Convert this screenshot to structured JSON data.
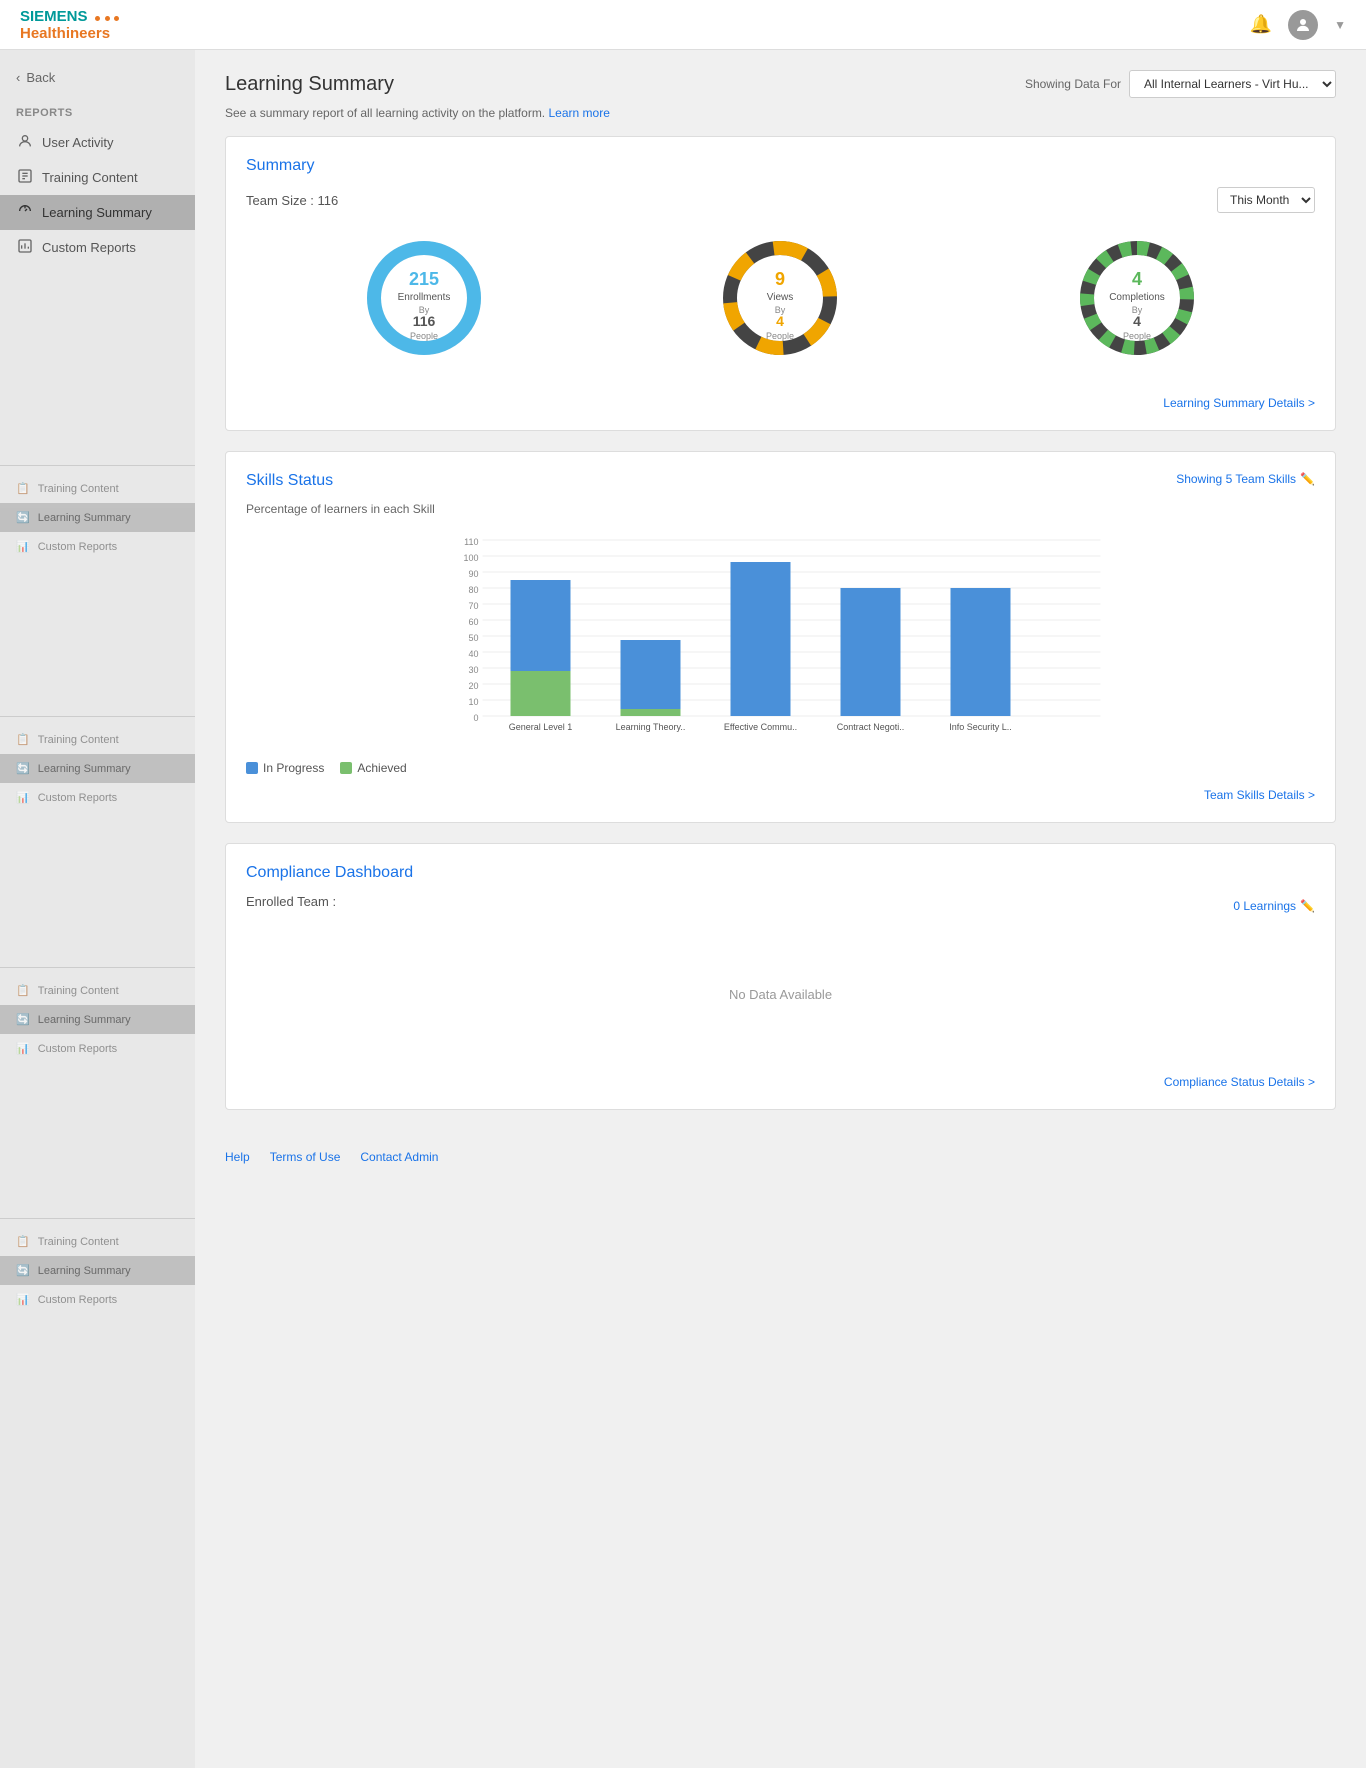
{
  "header": {
    "logo_siemens": "SIEMENS",
    "logo_healthineers": "Healthineers",
    "bell_icon": "🔔",
    "avatar_icon": "👤"
  },
  "sidebar": {
    "back_label": "Back",
    "reports_label": "REPORTS",
    "items": [
      {
        "id": "user-activity",
        "label": "User Activity",
        "icon": "👤",
        "active": false
      },
      {
        "id": "training-content",
        "label": "Training Content",
        "icon": "📋",
        "active": false
      },
      {
        "id": "learning-summary",
        "label": "Learning Summary",
        "icon": "🔄",
        "active": true
      },
      {
        "id": "custom-reports",
        "label": "Custom Reports",
        "icon": "📊",
        "active": false
      }
    ],
    "repeated_groups": [
      {
        "items": [
          {
            "label": "Training Content",
            "icon": "📋"
          },
          {
            "label": "Learning Summary",
            "icon": "🔄",
            "active": true
          },
          {
            "label": "Custom Reports",
            "icon": "📊"
          }
        ]
      },
      {
        "items": [
          {
            "label": "Training Content",
            "icon": "📋"
          },
          {
            "label": "Learning Summary",
            "icon": "🔄",
            "active": true
          },
          {
            "label": "Custom Reports",
            "icon": "📊"
          }
        ]
      },
      {
        "items": [
          {
            "label": "Training Content",
            "icon": "📋"
          },
          {
            "label": "Learning Summary",
            "icon": "🔄",
            "active": true
          },
          {
            "label": "Custom Reports",
            "icon": "📊"
          }
        ]
      },
      {
        "items": [
          {
            "label": "Training Content",
            "icon": "📋"
          },
          {
            "label": "Learning Summary",
            "icon": "🔄",
            "active": true
          },
          {
            "label": "Custom Reports",
            "icon": "📊"
          }
        ]
      }
    ]
  },
  "page": {
    "title": "Learning Summary",
    "showing_data_for_label": "Showing Data For",
    "data_selector": "All Internal Learners - Virt Hu...",
    "subtitle": "See a summary report of all learning activity on the platform.",
    "learn_more": "Learn more"
  },
  "summary_card": {
    "title": "Summary",
    "team_size_label": "Team Size : 116",
    "month_selector": "This Month",
    "enrollments": {
      "number": "215",
      "label": "Enrollments",
      "by_label": "By",
      "people_number": "116",
      "people_label": "People",
      "color": "#4db8e8"
    },
    "views": {
      "number": "9",
      "label": "Views",
      "by_label": "By",
      "people_number": "4",
      "people_label": "People",
      "color": "#f0a500"
    },
    "completions": {
      "number": "4",
      "label": "Completions",
      "by_label": "By",
      "people_number": "4",
      "people_label": "People",
      "color": "#5cb85c"
    },
    "details_link": "Learning Summary Details >"
  },
  "skills_card": {
    "title": "Skills Status",
    "subtitle": "Percentage of learners in each Skill",
    "showing_label": "Showing 5 Team Skills",
    "bars": [
      {
        "label": "General Level 1",
        "in_progress": 85,
        "achieved": 28
      },
      {
        "label": "Learning Theory..",
        "in_progress": 53,
        "achieved": 5
      },
      {
        "label": "Effective Commu..",
        "in_progress": 96,
        "achieved": 0
      },
      {
        "label": "Contract Negoti..",
        "in_progress": 80,
        "achieved": 0
      },
      {
        "label": "Info Security L..",
        "in_progress": 80,
        "achieved": 0
      }
    ],
    "legend": [
      {
        "label": "In Progress",
        "color": "#4a90d9"
      },
      {
        "label": "Achieved",
        "color": "#7abf6e"
      }
    ],
    "details_link": "Team Skills Details >",
    "y_max": 110,
    "y_labels": [
      "110",
      "100",
      "90",
      "80",
      "70",
      "60",
      "50",
      "40",
      "30",
      "20",
      "10",
      "0"
    ]
  },
  "compliance_card": {
    "title": "Compliance Dashboard",
    "enrolled_label": "Enrolled Team :",
    "learnings_link": "0 Learnings",
    "no_data": "No Data Available",
    "details_link": "Compliance Status Details >"
  },
  "footer": {
    "help": "Help",
    "terms": "Terms of Use",
    "contact": "Contact Admin"
  }
}
